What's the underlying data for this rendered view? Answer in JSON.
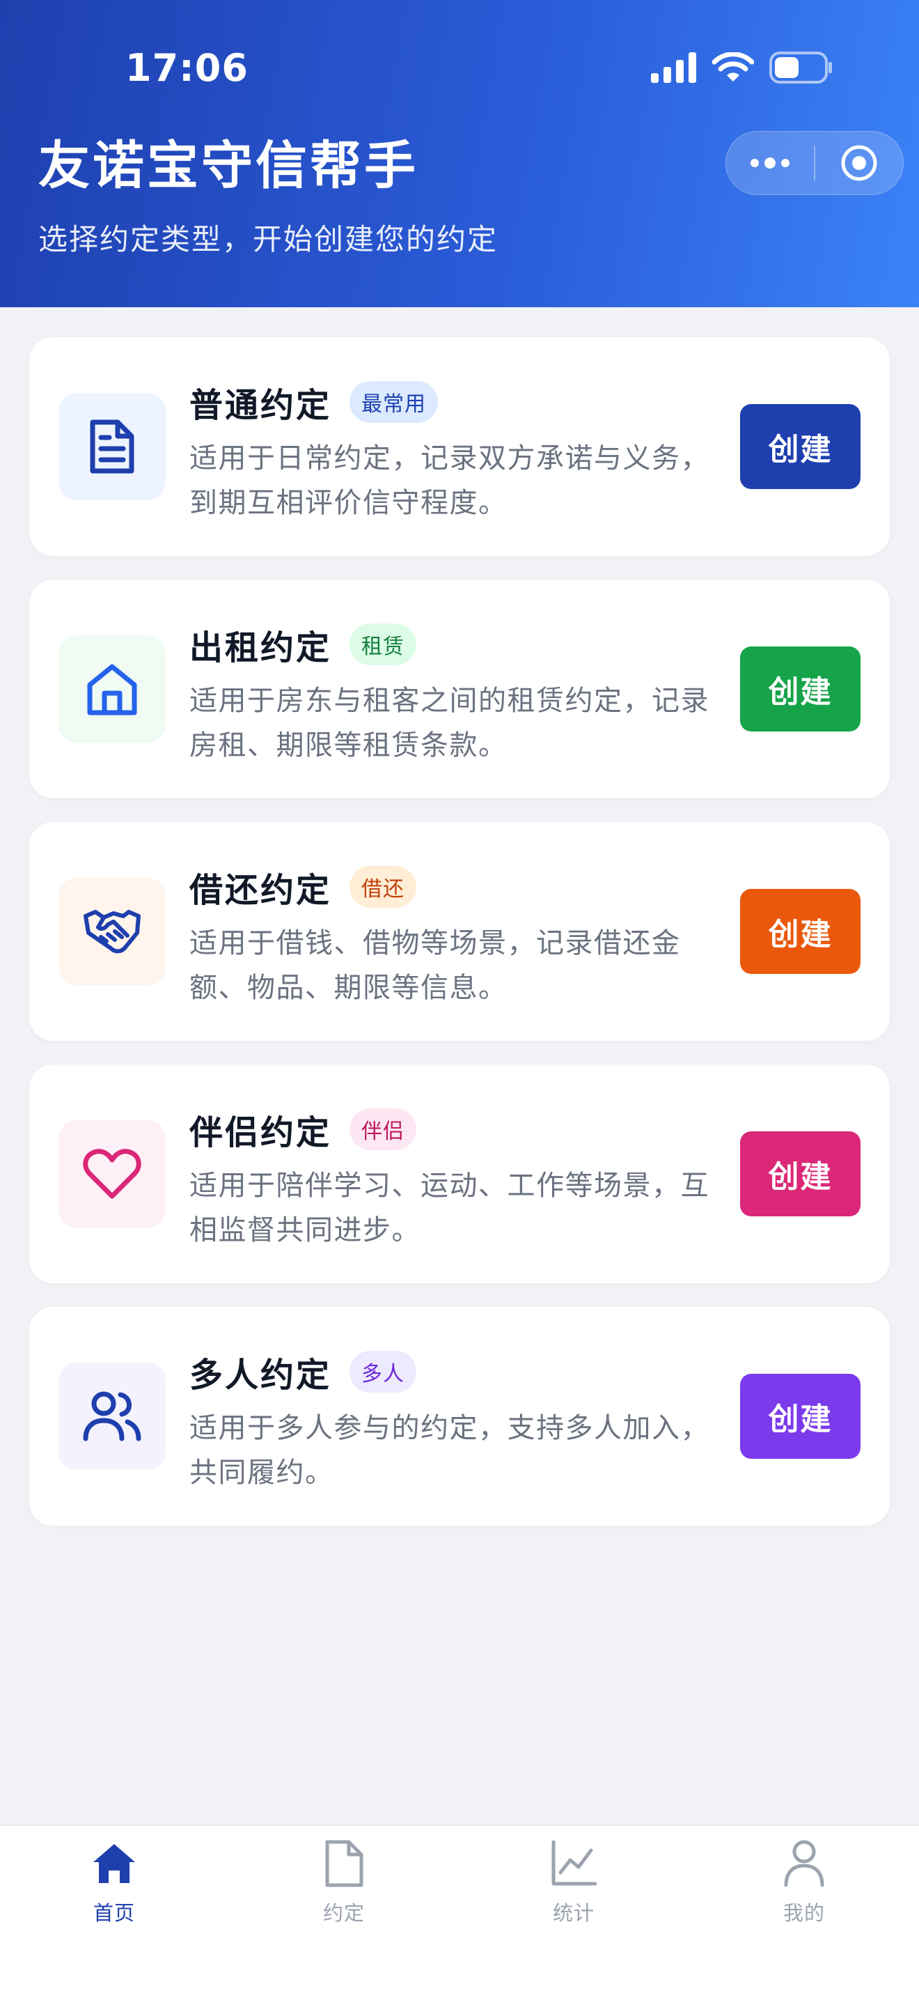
{
  "status_bar": {
    "time": "17:06"
  },
  "header": {
    "title": "友诺宝守信帮手",
    "subtitle": "选择约定类型，开始创建您的约定"
  },
  "cards": [
    {
      "title": "普通约定",
      "tag": "最常用",
      "desc_line1": "适用于日常约定，记录双方承诺与义务，",
      "desc_line2": "到期互相评价信守程度。",
      "button": "创建",
      "icon": "document-icon",
      "accent": "#1e3fad"
    },
    {
      "title": "出租约定",
      "tag": "租赁",
      "desc_line1": "适用于房东与租客之间的租赁约定，记录",
      "desc_line2": "房租、期限等租赁条款。",
      "button": "创建",
      "icon": "house-icon",
      "accent": "#16a34a"
    },
    {
      "title": "借还约定",
      "tag": "借还",
      "desc_line1": "适用于借钱、借物等场景，记录借还金",
      "desc_line2": "额、物品、期限等信息。",
      "button": "创建",
      "icon": "handshake-icon",
      "accent": "#ea580c"
    },
    {
      "title": "伴侣约定",
      "tag": "伴侣",
      "desc_line1": "适用于陪伴学习、运动、工作等场景，互",
      "desc_line2": "相监督共同进步。",
      "button": "创建",
      "icon": "heart-icon",
      "accent": "#db2777"
    },
    {
      "title": "多人约定",
      "tag": "多人",
      "desc_line1": "适用于多人参与的约定，支持多人加入，",
      "desc_line2": "共同履约。",
      "button": "创建",
      "icon": "users-icon",
      "accent": "#7c3aed"
    }
  ],
  "tabbar": [
    {
      "label": "首页",
      "icon": "home-icon",
      "active": true
    },
    {
      "label": "约定",
      "icon": "file-icon",
      "active": false
    },
    {
      "label": "统计",
      "icon": "chart-icon",
      "active": false
    },
    {
      "label": "我的",
      "icon": "user-icon",
      "active": false
    }
  ]
}
